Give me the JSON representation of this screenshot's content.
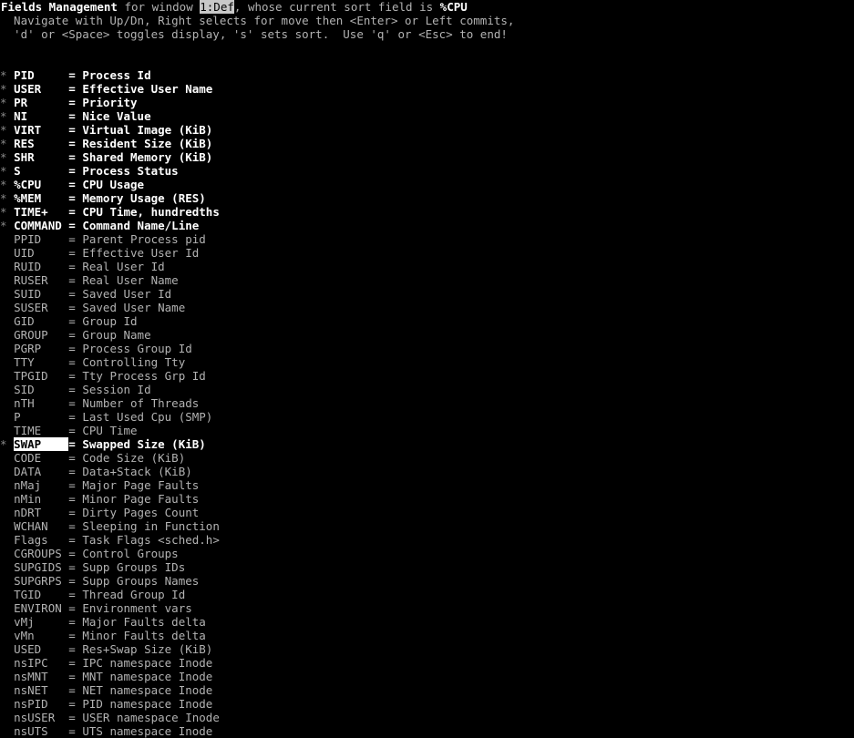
{
  "terminal": {
    "title": "Fields Management",
    "header": {
      "prefix": "Fields Management",
      "mid": " for window ",
      "window": "1:Def",
      "suffix": ", whose current sort field is ",
      "sort_field": "%CPU"
    },
    "help_line_1": "  Navigate with Up/Dn, Right selects for move then <Enter> or Left commits,",
    "help_line_2": "  'd' or <Space> toggles display, 's' sets sort.  Use 'q' or <Esc> to end!",
    "colors": {
      "background": "#000000",
      "dim_text": "#b2b2b2",
      "bold_text": "#ffffff",
      "header_highlight_bg": "#c8c8c8",
      "selection_highlight_bg": "#ffffff"
    },
    "markers": {
      "enabled": "*",
      "disabled": " ",
      "separator": "="
    },
    "fields": [
      {
        "marker": "*",
        "name": "PID",
        "desc": "Process Id",
        "enabled": true,
        "selected": false
      },
      {
        "marker": "*",
        "name": "USER",
        "desc": "Effective User Name",
        "enabled": true,
        "selected": false
      },
      {
        "marker": "*",
        "name": "PR",
        "desc": "Priority",
        "enabled": true,
        "selected": false
      },
      {
        "marker": "*",
        "name": "NI",
        "desc": "Nice Value",
        "enabled": true,
        "selected": false
      },
      {
        "marker": "*",
        "name": "VIRT",
        "desc": "Virtual Image (KiB)",
        "enabled": true,
        "selected": false
      },
      {
        "marker": "*",
        "name": "RES",
        "desc": "Resident Size (KiB)",
        "enabled": true,
        "selected": false
      },
      {
        "marker": "*",
        "name": "SHR",
        "desc": "Shared Memory (KiB)",
        "enabled": true,
        "selected": false
      },
      {
        "marker": "*",
        "name": "S",
        "desc": "Process Status",
        "enabled": true,
        "selected": false
      },
      {
        "marker": "*",
        "name": "%CPU",
        "desc": "CPU Usage",
        "enabled": true,
        "selected": false
      },
      {
        "marker": "*",
        "name": "%MEM",
        "desc": "Memory Usage (RES)",
        "enabled": true,
        "selected": false
      },
      {
        "marker": "*",
        "name": "TIME+",
        "desc": "CPU Time, hundredths",
        "enabled": true,
        "selected": false
      },
      {
        "marker": "*",
        "name": "COMMAND",
        "desc": "Command Name/Line",
        "enabled": true,
        "selected": false
      },
      {
        "marker": " ",
        "name": "PPID",
        "desc": "Parent Process pid",
        "enabled": false,
        "selected": false
      },
      {
        "marker": " ",
        "name": "UID",
        "desc": "Effective User Id",
        "enabled": false,
        "selected": false
      },
      {
        "marker": " ",
        "name": "RUID",
        "desc": "Real User Id",
        "enabled": false,
        "selected": false
      },
      {
        "marker": " ",
        "name": "RUSER",
        "desc": "Real User Name",
        "enabled": false,
        "selected": false
      },
      {
        "marker": " ",
        "name": "SUID",
        "desc": "Saved User Id",
        "enabled": false,
        "selected": false
      },
      {
        "marker": " ",
        "name": "SUSER",
        "desc": "Saved User Name",
        "enabled": false,
        "selected": false
      },
      {
        "marker": " ",
        "name": "GID",
        "desc": "Group Id",
        "enabled": false,
        "selected": false
      },
      {
        "marker": " ",
        "name": "GROUP",
        "desc": "Group Name",
        "enabled": false,
        "selected": false
      },
      {
        "marker": " ",
        "name": "PGRP",
        "desc": "Process Group Id",
        "enabled": false,
        "selected": false
      },
      {
        "marker": " ",
        "name": "TTY",
        "desc": "Controlling Tty",
        "enabled": false,
        "selected": false
      },
      {
        "marker": " ",
        "name": "TPGID",
        "desc": "Tty Process Grp Id",
        "enabled": false,
        "selected": false
      },
      {
        "marker": " ",
        "name": "SID",
        "desc": "Session Id",
        "enabled": false,
        "selected": false
      },
      {
        "marker": " ",
        "name": "nTH",
        "desc": "Number of Threads",
        "enabled": false,
        "selected": false
      },
      {
        "marker": " ",
        "name": "P",
        "desc": "Last Used Cpu (SMP)",
        "enabled": false,
        "selected": false
      },
      {
        "marker": " ",
        "name": "TIME",
        "desc": "CPU Time",
        "enabled": false,
        "selected": false
      },
      {
        "marker": "*",
        "name": "SWAP",
        "desc": "Swapped Size (KiB)",
        "enabled": true,
        "selected": true
      },
      {
        "marker": " ",
        "name": "CODE",
        "desc": "Code Size (KiB)",
        "enabled": false,
        "selected": false
      },
      {
        "marker": " ",
        "name": "DATA",
        "desc": "Data+Stack (KiB)",
        "enabled": false,
        "selected": false
      },
      {
        "marker": " ",
        "name": "nMaj",
        "desc": "Major Page Faults",
        "enabled": false,
        "selected": false
      },
      {
        "marker": " ",
        "name": "nMin",
        "desc": "Minor Page Faults",
        "enabled": false,
        "selected": false
      },
      {
        "marker": " ",
        "name": "nDRT",
        "desc": "Dirty Pages Count",
        "enabled": false,
        "selected": false
      },
      {
        "marker": " ",
        "name": "WCHAN",
        "desc": "Sleeping in Function",
        "enabled": false,
        "selected": false
      },
      {
        "marker": " ",
        "name": "Flags",
        "desc": "Task Flags <sched.h>",
        "enabled": false,
        "selected": false
      },
      {
        "marker": " ",
        "name": "CGROUPS",
        "desc": "Control Groups",
        "enabled": false,
        "selected": false
      },
      {
        "marker": " ",
        "name": "SUPGIDS",
        "desc": "Supp Groups IDs",
        "enabled": false,
        "selected": false
      },
      {
        "marker": " ",
        "name": "SUPGRPS",
        "desc": "Supp Groups Names",
        "enabled": false,
        "selected": false
      },
      {
        "marker": " ",
        "name": "TGID",
        "desc": "Thread Group Id",
        "enabled": false,
        "selected": false
      },
      {
        "marker": " ",
        "name": "ENVIRON",
        "desc": "Environment vars",
        "enabled": false,
        "selected": false
      },
      {
        "marker": " ",
        "name": "vMj",
        "desc": "Major Faults delta",
        "enabled": false,
        "selected": false
      },
      {
        "marker": " ",
        "name": "vMn",
        "desc": "Minor Faults delta",
        "enabled": false,
        "selected": false
      },
      {
        "marker": " ",
        "name": "USED",
        "desc": "Res+Swap Size (KiB)",
        "enabled": false,
        "selected": false
      },
      {
        "marker": " ",
        "name": "nsIPC",
        "desc": "IPC namespace Inode",
        "enabled": false,
        "selected": false
      },
      {
        "marker": " ",
        "name": "nsMNT",
        "desc": "MNT namespace Inode",
        "enabled": false,
        "selected": false
      },
      {
        "marker": " ",
        "name": "nsNET",
        "desc": "NET namespace Inode",
        "enabled": false,
        "selected": false
      },
      {
        "marker": " ",
        "name": "nsPID",
        "desc": "PID namespace Inode",
        "enabled": false,
        "selected": false
      },
      {
        "marker": " ",
        "name": "nsUSER",
        "desc": "USER namespace Inode",
        "enabled": false,
        "selected": false
      },
      {
        "marker": " ",
        "name": "nsUTS",
        "desc": "UTS namespace Inode",
        "enabled": false,
        "selected": false
      }
    ]
  }
}
